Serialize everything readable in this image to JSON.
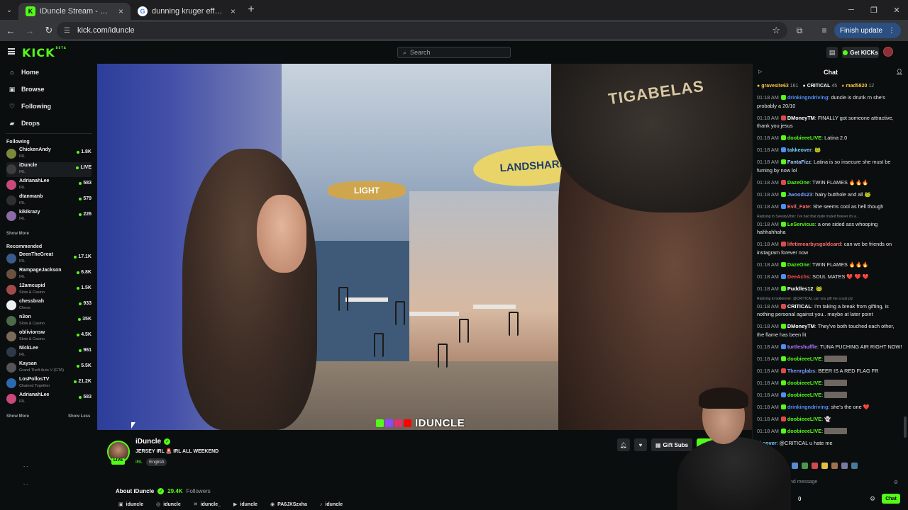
{
  "browser": {
    "tabs": [
      {
        "title": "iDuncle Stream - Watch Live on",
        "icon": "kick-favicon"
      },
      {
        "title": "dunning kruger effect - Google",
        "icon": "google-favicon"
      }
    ],
    "url": "kick.com/iduncle",
    "finish_update": "Finish update"
  },
  "header": {
    "logo": "KICK",
    "logo_sup": "BETA",
    "search_placeholder": "Search",
    "get_kicks": "Get KICKs"
  },
  "sidebar": {
    "nav": [
      {
        "label": "Home",
        "icon": "home-icon"
      },
      {
        "label": "Browse",
        "icon": "compass-icon"
      },
      {
        "label": "Following",
        "icon": "heart-icon"
      },
      {
        "label": "Drops",
        "icon": "gift-icon"
      }
    ],
    "following_title": "Following",
    "following": [
      {
        "name": "ChickenAndy",
        "category": "IRL",
        "viewers": "1.8K",
        "color": "#7a8a3a"
      },
      {
        "name": "iDuncle",
        "category": "IRL",
        "viewers": "LIVE",
        "color": "#3d3d3d"
      },
      {
        "name": "AdrianahLee",
        "category": "IRL",
        "viewers": "583",
        "color": "#c94a7a"
      },
      {
        "name": "dtanmanb",
        "category": "IRL",
        "viewers": "579",
        "color": "#2e2e2e"
      },
      {
        "name": "kikikrazy",
        "category": "IRL",
        "viewers": "226",
        "color": "#8a6aa8"
      }
    ],
    "show_more": "Show More",
    "recommended_title": "Recommended",
    "recommended": [
      {
        "name": "DeenTheGreat",
        "category": "IRL",
        "viewers": "17.1K",
        "color": "#3a5b8a"
      },
      {
        "name": "RampageJackson",
        "category": "IRL",
        "viewers": "6.8K",
        "color": "#6b5140"
      },
      {
        "name": "12amcupid",
        "category": "Slots & Casino",
        "viewers": "1.5K",
        "color": "#a04a4a"
      },
      {
        "name": "chessbrah",
        "category": "Chess",
        "viewers": "933",
        "color": "#f0f0f0"
      },
      {
        "name": "n3on",
        "category": "Slots & Casino",
        "viewers": "35K",
        "color": "#4a6a4a"
      },
      {
        "name": "oblivionsw",
        "category": "Slots & Casino",
        "viewers": "4.5K",
        "color": "#7a6a5a"
      },
      {
        "name": "NickLee",
        "category": "IRL",
        "viewers": "961",
        "color": "#2e3a4a"
      },
      {
        "name": "Kaysan",
        "category": "Grand Theft Auto V (GTA)",
        "viewers": "5.5K",
        "color": "#555555"
      },
      {
        "name": "LosPollosTV",
        "category": "Chained Together",
        "viewers": "21.2K",
        "color": "#2a6ab0"
      },
      {
        "name": "AdrianahLee",
        "category": "IRL",
        "viewers": "583",
        "color": "#c94a7a"
      }
    ],
    "show_more_2": "Show More",
    "show_less": "Show Less",
    "dash_a": "- -",
    "dash_b": "- -"
  },
  "video": {
    "cap_text": "TIGABELAS",
    "sign_1": "LANDSHARK",
    "sign_2": "LIGHT",
    "overlay_text": "IDUNCLE"
  },
  "stream": {
    "name": "iDuncle",
    "live_badge": "LIVE",
    "title": "JERSEY IRL 🚨 IRL ALL WEEKEND",
    "category": "IRL",
    "language": "English",
    "gift_subs": "Gift Subs",
    "about_label": "About iDuncle",
    "followers_count": "29.4K",
    "followers_label": "Followers",
    "socials": [
      {
        "label": "iduncle",
        "icon": "kick-icon"
      },
      {
        "label": "iduncle",
        "icon": "instagram-icon"
      },
      {
        "label": "iduncle_",
        "icon": "x-icon"
      },
      {
        "label": "iduncle",
        "icon": "youtube-icon"
      },
      {
        "label": "PA6JXSzxha",
        "icon": "discord-icon"
      },
      {
        "label": "iduncle",
        "icon": "tiktok-icon"
      }
    ]
  },
  "chat": {
    "title": "Chat",
    "pinned": [
      {
        "name": "gravesite63",
        "count": "161"
      },
      {
        "name": "CRITICAL",
        "count": "45"
      },
      {
        "name": "mad5820",
        "count": "12"
      }
    ],
    "messages": [
      {
        "ts": "01:18 AM",
        "user": "drinkingndriving",
        "color": "#4f8ef7",
        "text": ": duncle is drunk rn she's probably a 20/10"
      },
      {
        "ts": "01:18 AM",
        "user": "DMoneyTM",
        "color": "#ffffff",
        "text": ": FINALLY got someone attractive, thank you jesus"
      },
      {
        "ts": "01:18 AM",
        "user": "doobieeeLIVE",
        "color": "#53fc18",
        "text": ": Latina 2.0"
      },
      {
        "ts": "01:18 AM",
        "user": "takkeover",
        "color": "#72d0ff",
        "text": ": 🐸"
      },
      {
        "ts": "01:18 AM",
        "user": "FantaFizz",
        "color": "#a8c8ff",
        "text": ": Latina is so insecure she must be fuming by now lol"
      },
      {
        "ts": "01:18 AM",
        "user": "DazeOne",
        "color": "#53fc18",
        "text": ": TWIN FLAMES 🔥🔥🔥"
      },
      {
        "ts": "01:18 AM",
        "user": "Jwoods23",
        "color": "#7a9cff",
        "text": ": hairy butthole and all 🐸"
      },
      {
        "ts": "01:18 AM",
        "user": "Evil_Fate",
        "color": "#ff6b6b",
        "text": ": She seems cool as hell though"
      },
      {
        "ts": "01:18 AM",
        "reply": "Replying to SweatyVibin: I've had that dude muted forever it's a...",
        "user": "LeServicus",
        "color": "#53fc18",
        "text": ": a one sided ass whooping hahhahhaha"
      },
      {
        "ts": "01:18 AM",
        "user": "lifetimearbysgoldcard",
        "color": "#ff6b6b",
        "text": ": can we be friends on instagram forever now"
      },
      {
        "ts": "01:18 AM",
        "user": "DazeOne",
        "color": "#53fc18",
        "text": ": TWIN FLAMES 🔥🔥🔥"
      },
      {
        "ts": "01:18 AM",
        "user": "DeeAchs",
        "color": "#ff4d4d",
        "text": ": SOUL MATES ❤️ ❤️ ❤️"
      },
      {
        "ts": "01:18 AM",
        "user": "Puddles12",
        "color": "#ffffff",
        "text": ": 🐸"
      },
      {
        "ts": "01:18 AM",
        "reply": "Replying to takkeover: @CRITICAL can you gift me a sub plz",
        "user": "CRITICAL",
        "color": "#ffffff",
        "text": ": I'm taking a break from gifting, is nothing personal against you.. maybe at later point"
      },
      {
        "ts": "01:18 AM",
        "user": "DMoneyTM",
        "color": "#ffffff",
        "text": ": They've both touched each other, the flame has been lit"
      },
      {
        "ts": "01:18 AM",
        "user": "turtleshuffle",
        "color": "#b07cff",
        "text": ": TUNA PUCHING AIR RIGHT NOW!"
      },
      {
        "ts": "01:18 AM",
        "user": "doobieeeLIVE",
        "color": "#53fc18",
        "text": ": ",
        "blur": true
      },
      {
        "ts": "01:18 AM",
        "user": "Thenrglabs",
        "color": "#7a9cff",
        "text": ": BEER IS A RED FLAG FR"
      },
      {
        "ts": "01:18 AM",
        "user": "doobieeeLIVE",
        "color": "#53fc18",
        "text": ": ",
        "blur": true
      },
      {
        "ts": "01:18 AM",
        "user": "doobieeeLIVE",
        "color": "#53fc18",
        "text": ": ",
        "blur": true
      },
      {
        "ts": "01:18 AM",
        "user": "drinkingndriving",
        "color": "#4f8ef7",
        "text": ": she's the one ❤️"
      },
      {
        "ts": "01:18 AM",
        "user": "doobieeeLIVE",
        "color": "#53fc18",
        "text": ": 👻"
      },
      {
        "ts": "01:18 AM",
        "user": "doobieeeLIVE",
        "color": "#53fc18",
        "text": ": ",
        "blur": true
      },
      {
        "ts": "",
        "user": "kkeover",
        "color": "#72d0ff",
        "text": ": @CRITICAL u hate me"
      }
    ],
    "input_placeholder": "nd message",
    "points": "0",
    "send_label": "Chat"
  },
  "colors": {
    "accent": "#53fc18",
    "background": "#0b0e0f"
  }
}
